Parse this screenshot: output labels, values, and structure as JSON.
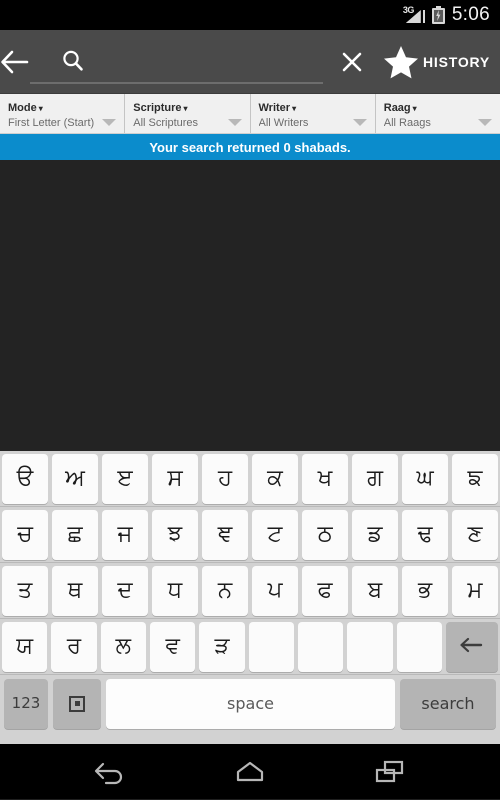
{
  "status_bar": {
    "network_label": "3G",
    "time": "5:06",
    "signal_icon": "signal-3g-icon",
    "battery_icon": "battery-charging-icon"
  },
  "action_bar": {
    "back_icon": "back-arrow-icon",
    "search_icon": "search-icon",
    "search_value": "",
    "search_placeholder": "",
    "clear_icon": "close-x-icon",
    "star_icon": "star-icon",
    "history_label": "HISTORY"
  },
  "filters": [
    {
      "title": "Mode",
      "caret": "▾",
      "value": "First Letter (Start)"
    },
    {
      "title": "Scripture",
      "caret": "▾",
      "value": "All Scriptures"
    },
    {
      "title": "Writer",
      "caret": "▾",
      "value": "All Writers"
    },
    {
      "title": "Raag",
      "caret": "▾",
      "value": "All Raags"
    }
  ],
  "banner": {
    "text": "Your search returned 0 shabads.",
    "color": "#0b8ccc"
  },
  "content": {
    "background": "#232323",
    "items": []
  },
  "keyboard": {
    "rows": [
      {
        "keys": [
          "ੳ",
          "ਅ",
          "ੲ",
          "ਸ",
          "ਹ",
          "ਕ",
          "ਖ",
          "ਗ",
          "ਘ",
          "ਙ"
        ]
      },
      {
        "keys": [
          "ਚ",
          "ਛ",
          "ਜ",
          "ਝ",
          "ਞ",
          "ਟ",
          "ਠ",
          "ਡ",
          "ਢ",
          "ਣ"
        ]
      },
      {
        "keys": [
          "ਤ",
          "ਥ",
          "ਦ",
          "ਧ",
          "ਨ",
          "ਪ",
          "ਫ",
          "ਬ",
          "ਭ",
          "ਮ"
        ]
      },
      {
        "keys": [
          "ਯ",
          "ਰ",
          "ਲ",
          "ਵ",
          "ੜ",
          "",
          "",
          "",
          ""
        ]
      }
    ],
    "backspace_label": "",
    "backspace_icon": "backspace-icon",
    "numeric_label": "123",
    "ime_icon": "ime-switch-icon",
    "space_label": "space",
    "search_label": "search"
  },
  "nav_bar": {
    "back_icon": "nav-back-icon",
    "home_icon": "nav-home-icon",
    "recents_icon": "nav-recents-icon"
  }
}
